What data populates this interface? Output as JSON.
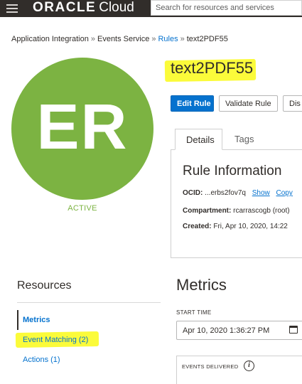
{
  "header": {
    "brand_oracle": "ORACLE",
    "brand_cloud": "Cloud",
    "search_placeholder": "Search for resources and services"
  },
  "breadcrumb": {
    "items": [
      "Application Integration",
      "Events Service",
      "Rules",
      "text2PDF55"
    ],
    "separator": "»"
  },
  "avatar": {
    "initials": "ER",
    "status": "ACTIVE",
    "color": "#7cb342"
  },
  "title": "text2PDF55",
  "toolbar": {
    "edit_label": "Edit Rule",
    "validate_label": "Validate Rule",
    "cut_label": "Dis"
  },
  "tabs": {
    "details": "Details",
    "tags": "Tags"
  },
  "rule_info": {
    "heading": "Rule Information",
    "ocid_label": "OCID:",
    "ocid_value": "...erbs2fov7q",
    "show_link": "Show",
    "copy_link": "Copy",
    "compartment_label": "Compartment:",
    "compartment_value": "rcarrascogb (root)",
    "created_label": "Created:",
    "created_value": "Fri, Apr 10, 2020, 14:22"
  },
  "resources": {
    "heading": "Resources",
    "items": [
      "Metrics",
      "Event Matching (2)",
      "Actions (1)"
    ]
  },
  "metrics": {
    "heading": "Metrics",
    "start_time_label": "START TIME",
    "start_time_value": "Apr 10, 2020 1:36:27 PM",
    "chart_label": "EVENTS DELIVERED",
    "info_glyph": "i"
  },
  "colors": {
    "accent": "#0572ce",
    "highlight": "#fbfb3a",
    "topbar": "#312d2a",
    "active": "#7cb342"
  }
}
